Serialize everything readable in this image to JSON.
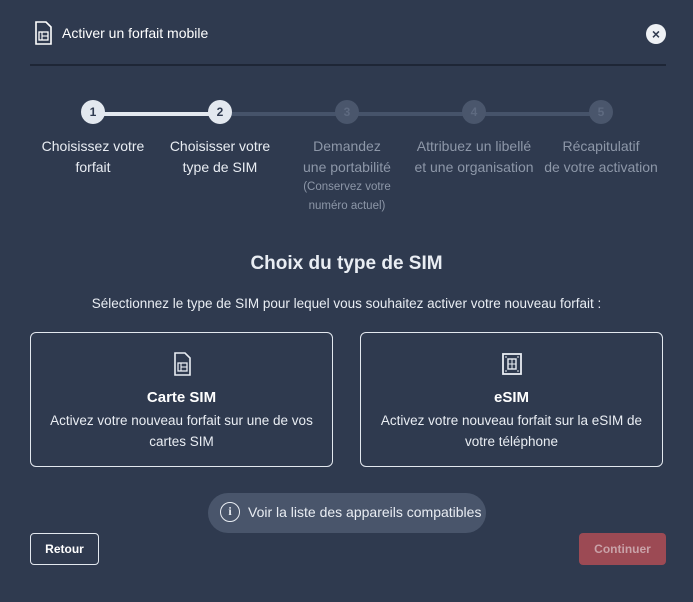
{
  "header": {
    "title": "Activer un forfait mobile",
    "close_symbol": "×"
  },
  "stepper": {
    "steps": [
      {
        "number": "1",
        "label_line1": "Choisissez votre",
        "label_line2": "forfait",
        "sub": "",
        "state": "completed"
      },
      {
        "number": "2",
        "label_line1": "Choisisser votre",
        "label_line2": "type de SIM",
        "sub": "",
        "state": "current"
      },
      {
        "number": "3",
        "label_line1": "Demandez",
        "label_line2": "une portabilité",
        "sub_line1": "(Conservez votre",
        "sub_line2": "numéro actuel)",
        "state": "upcoming"
      },
      {
        "number": "4",
        "label_line1": "Attribuez un libellé",
        "label_line2": "et une organisation",
        "sub": "",
        "state": "upcoming"
      },
      {
        "number": "5",
        "label_line1": "Récapitulatif",
        "label_line2": "de votre activation",
        "sub": "",
        "state": "upcoming"
      }
    ]
  },
  "content": {
    "title": "Choix du type de SIM",
    "subtitle": "Sélectionnez le type de SIM pour lequel vous souhaitez activer votre nouveau forfait :",
    "cards": [
      {
        "icon": "sim-card-icon",
        "title": "Carte SIM",
        "desc_line1": "Activez votre nouveau forfait sur une de vos",
        "desc_line2": "cartes SIM"
      },
      {
        "icon": "esim-chip-icon",
        "title": "eSIM",
        "desc_line1": "Activez votre nouveau forfait sur la eSIM de",
        "desc_line2": "votre téléphone"
      }
    ],
    "compat_link": "Voir la liste des appareils compatibles",
    "info_symbol": "i"
  },
  "footer": {
    "back_label": "Retour",
    "continue_label": "Continuer"
  },
  "colors": {
    "background": "#2f3a4f",
    "accent_disabled": "#9c4a54",
    "track_done": "#e3e8ef",
    "track_todo": "#46536a"
  }
}
